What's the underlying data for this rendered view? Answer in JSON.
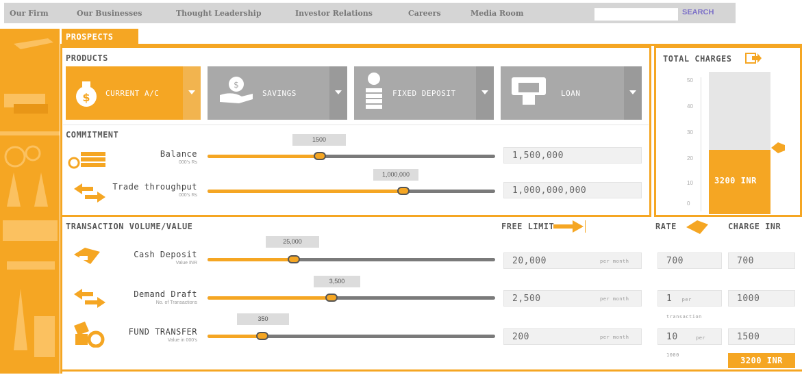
{
  "nav": {
    "items": [
      "Our Firm",
      "Our Businesses",
      "Thought Leadership",
      "Investor Relations",
      "Careers",
      "Media Room"
    ],
    "search_label": "SEARCH",
    "search_value": ""
  },
  "tab": {
    "label": "PROSPECTS"
  },
  "products": {
    "title": "PRODUCTS",
    "items": [
      {
        "label": "CURRENT A/C",
        "icon": "money-bag-icon",
        "active": true
      },
      {
        "label": "SAVINGS",
        "icon": "hand-coin-icon",
        "active": false
      },
      {
        "label": "FIXED DEPOSIT",
        "icon": "coin-stack-icon",
        "active": false
      },
      {
        "label": "LOAN",
        "icon": "atm-icon",
        "active": false
      }
    ]
  },
  "commitment": {
    "title": "COMMITMENT",
    "rows": [
      {
        "label": "Balance",
        "sublabel": "000's Rs",
        "bubble": "1500",
        "value": "1,500,000",
        "level": 0.39,
        "icon": "cash-stack-icon"
      },
      {
        "label": "Trade throughput",
        "sublabel": "000's Rs",
        "bubble": "1,000,000",
        "value": "1,000,000,000",
        "level": 0.68,
        "icon": "exchange-arrows-icon"
      }
    ]
  },
  "total": {
    "title": "TOTAL CHARGES",
    "value": "3200 INR",
    "ticks": [
      "50",
      "40",
      "30",
      "20",
      "10",
      "0"
    ],
    "level": 0.45
  },
  "transactions": {
    "title": "TRANSACTION VOLUME/VALUE",
    "free_limit_label": "FREE LIMIT",
    "rate_label": "RATE",
    "charge_label": "CHARGE INR",
    "rows": [
      {
        "label": "Cash Deposit",
        "sublabel": "Value INR",
        "bubble": "25,000",
        "free": "20,000",
        "per": "per month",
        "rate": "700",
        "rate_unit": "",
        "charge": "700",
        "level": 0.3,
        "icon": "cash-hand-icon"
      },
      {
        "label": "Demand Draft",
        "sublabel": "No. of Transactions",
        "bubble": "3,500",
        "free": "2,500",
        "per": "per month",
        "rate": "1",
        "rate_unit": "per transaction",
        "charge": "1000",
        "level": 0.43,
        "icon": "exchange-arrows-icon"
      },
      {
        "label": "FUND TRANSFER",
        "sublabel": "Value in 000's",
        "bubble": "350",
        "free": "200",
        "per": "per month",
        "rate": "10",
        "rate_unit": "per 1000",
        "charge": "1500",
        "level": 0.19,
        "icon": "fund-transfer-icon"
      }
    ],
    "total": "3200 INR"
  },
  "colors": {
    "accent": "#f5a623",
    "gray": "#7a7a7a",
    "nav_bg": "#d5d5d5"
  }
}
